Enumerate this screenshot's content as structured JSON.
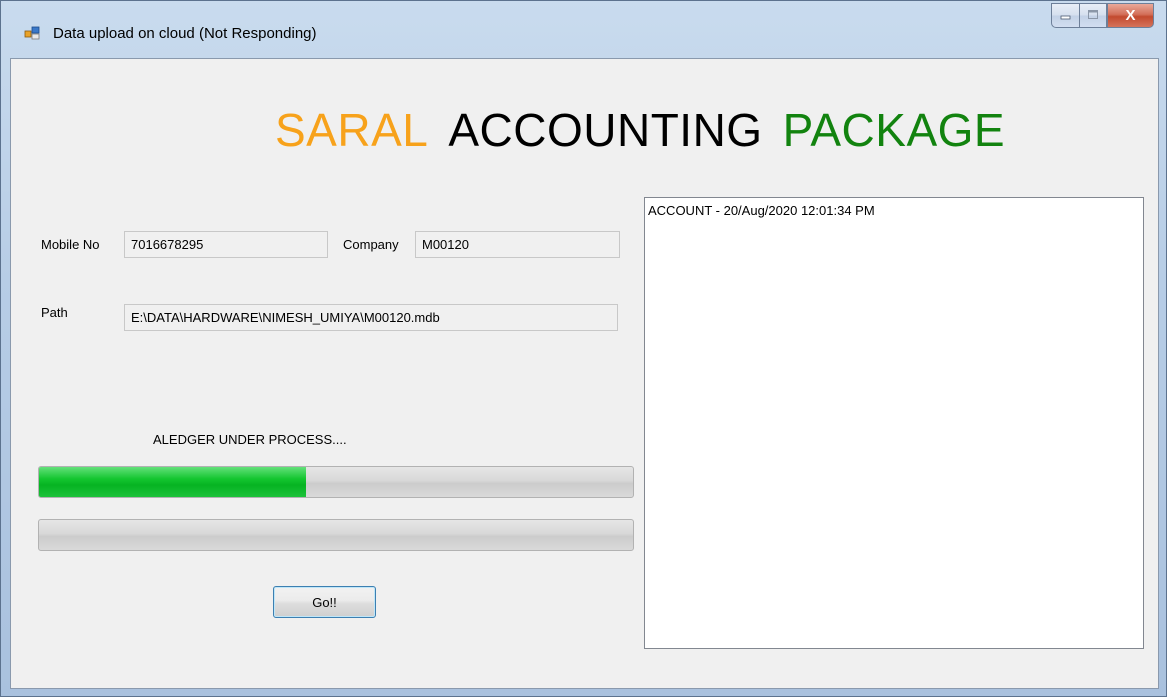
{
  "window": {
    "title": "Data upload on cloud (Not Responding)",
    "icon": "winforms-app-icon",
    "controls": {
      "minimize": "minimize-icon",
      "maximize": "maximize-icon",
      "close": "close-icon",
      "close_glyph": "X"
    }
  },
  "heading": {
    "word1": "SARAL",
    "word2": "ACCOUNTING",
    "word3": "PACKAGE",
    "colors": {
      "word1": "#f7a21b",
      "word2": "#000000",
      "word3": "#12830f"
    }
  },
  "form": {
    "mobile_label": "Mobile No",
    "mobile_value": "7016678295",
    "company_label": "Company",
    "company_value": "M00120",
    "path_label": "Path",
    "path_value": "E:\\DATA\\HARDWARE\\NIMESH_UMIYA\\M00120.mdb"
  },
  "status": {
    "text": "ALEDGER UNDER PROCESS...."
  },
  "progress": {
    "primary_fraction": 0.45,
    "secondary_fraction": 0,
    "fill_color": "#13c52f"
  },
  "go_button": {
    "label": "Go!!"
  },
  "log": {
    "items": [
      "ACCOUNT - 20/Aug/2020 12:01:34 PM"
    ]
  }
}
